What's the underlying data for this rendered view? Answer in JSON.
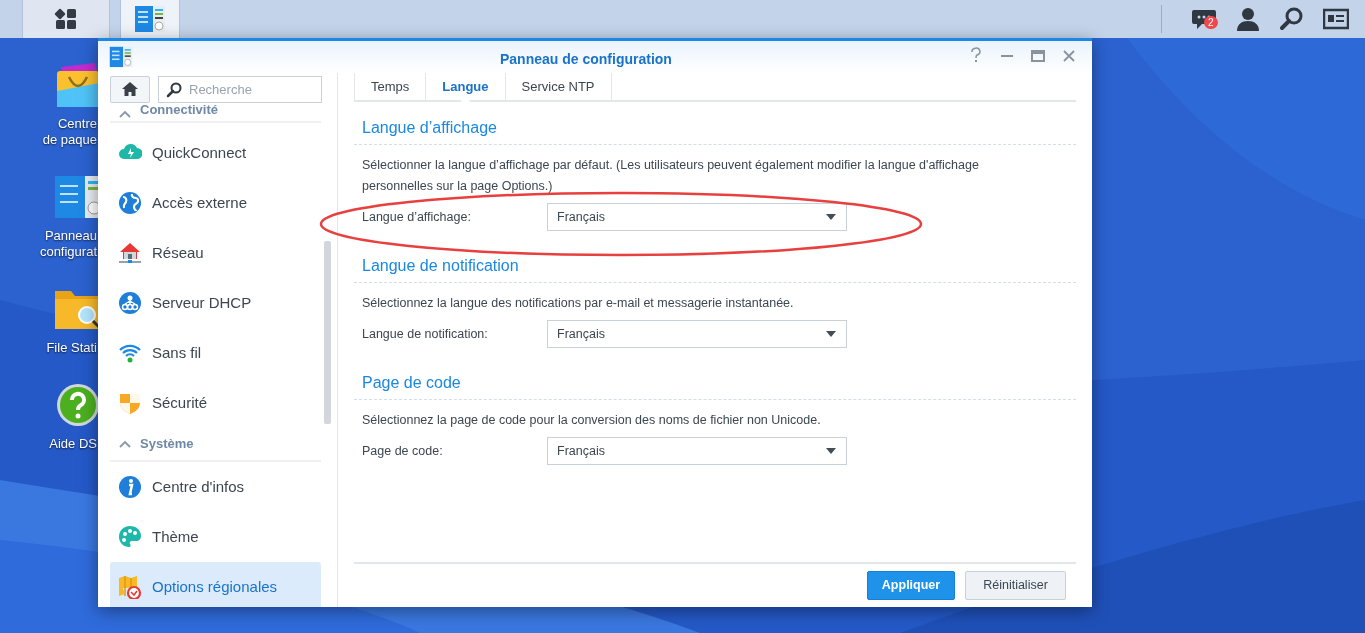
{
  "taskbar": {
    "buttons": [
      {
        "kind": "apps",
        "selected": false
      },
      {
        "kind": "control-panel",
        "selected": true
      }
    ],
    "tray": [
      {
        "kind": "chat",
        "badge": "2"
      },
      {
        "kind": "user"
      },
      {
        "kind": "search"
      },
      {
        "kind": "widgets"
      }
    ]
  },
  "desktop_icons": [
    {
      "kind": "package",
      "label_lines": [
        "Centre",
        "de paque"
      ]
    },
    {
      "kind": "control-panel",
      "label_lines": [
        "Panneau",
        "configurat"
      ]
    },
    {
      "kind": "folder",
      "label_lines": [
        "File Stati"
      ]
    },
    {
      "kind": "help",
      "label_lines": [
        "Aide DS"
      ]
    }
  ],
  "window": {
    "title": "Panneau de configuration",
    "sidebar": {
      "search": {
        "placeholder": "Recherche"
      },
      "sections": [
        {
          "title": "Connectivité",
          "expanded": true,
          "items": [
            {
              "label": "QuickConnect",
              "kind": "cloud",
              "selected": false
            },
            {
              "label": "Accès externe",
              "kind": "globe",
              "selected": false
            },
            {
              "label": "Réseau",
              "kind": "house",
              "selected": false
            },
            {
              "label": "Serveur DHCP",
              "kind": "dhcp",
              "selected": false
            },
            {
              "label": "Sans fil",
              "kind": "wifi",
              "selected": false
            },
            {
              "label": "Sécurité",
              "kind": "shield",
              "selected": false
            }
          ]
        },
        {
          "title": "Système",
          "expanded": true,
          "items": [
            {
              "label": "Centre d'infos",
              "kind": "info",
              "selected": false
            },
            {
              "label": "Thème",
              "kind": "palette",
              "selected": false
            },
            {
              "label": "Options régionales",
              "kind": "map",
              "selected": true
            }
          ]
        }
      ]
    },
    "tabs": [
      {
        "label": "Temps",
        "selected": false
      },
      {
        "label": "Langue",
        "selected": true
      },
      {
        "label": "Service NTP",
        "selected": false
      }
    ],
    "sections": [
      {
        "title": "Langue d’affichage",
        "description": "Sélectionner la langue d’affichage par défaut. (Les utilisateurs peuvent également modifier la langue d'affichage personnelles sur la page Options.)",
        "field_label": "Langue d’affichage:",
        "value": "Français",
        "highlighted": true
      },
      {
        "title": "Langue de notification",
        "description": "Sélectionnez la langue des notifications par e-mail et messagerie instantanée.",
        "field_label": "Langue de notification:",
        "value": "Français",
        "highlighted": false
      },
      {
        "title": "Page de code",
        "description": "Sélectionnez la page de code pour la conversion des noms de fichier non Unicode.",
        "field_label": "Page de code:",
        "value": "Français",
        "highlighted": false
      }
    ],
    "buttons": [
      {
        "label": "Appliquer",
        "kind": "primary"
      },
      {
        "label": "Réinitialiser",
        "kind": "secondary"
      }
    ]
  }
}
